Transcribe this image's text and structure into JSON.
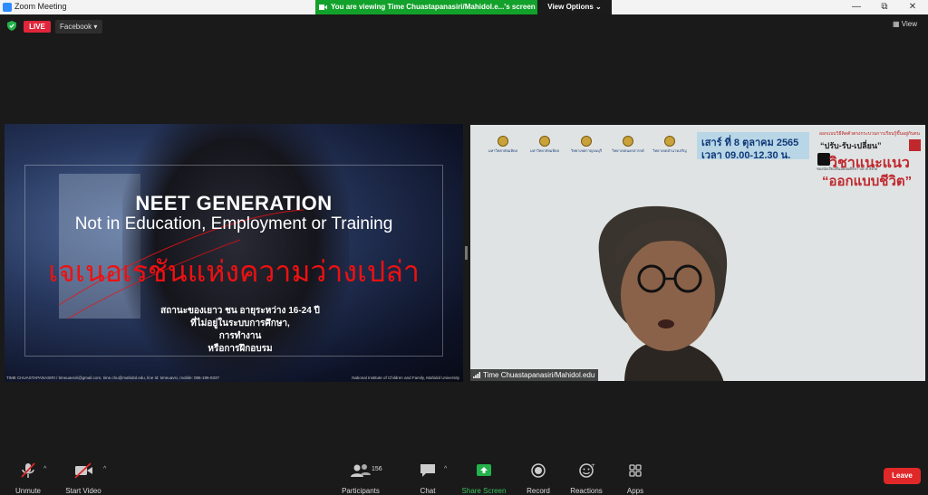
{
  "window": {
    "title": "Zoom Meeting",
    "banner_text": "You are viewing Time Chuastapanasiri/Mahidol.e...'s screen",
    "view_options_label": "View Options ⌄",
    "minimize": "—",
    "maximize": "⧉",
    "close": "✕"
  },
  "topbar": {
    "live_label": "LIVE",
    "live_platform": "Facebook ▾",
    "view_label": "View"
  },
  "shared_screen": {
    "title": "NEET GENERATION",
    "subtitle": "Not in Education, Employment or Training",
    "thai_title": "เจเนอเรชันแห่งความว่างเปล่า",
    "description": "สถานะของเยาว ชน อายุระหว่าง 16-24 ปี\nที่ไม่อยู่ในระบบการศึกษา,\nการทำงาน\nหรือการฝึกอบรม",
    "footer_left": "TIME CHUASTAPANASIRI / timeuavsiri@gmail.com, time.chu@mahidol.edu, line Id: timeuavsi, mobile: 086-195-9337",
    "footer_right": "National Institute of Children and Family, Mahidol University"
  },
  "participant_video": {
    "name": "Time Chuastapanasiri/Mahidol.edu",
    "logos": [
      {
        "name": "มหาวิทยาลัยมหิดล"
      },
      {
        "name": "มหาวิทยาลัยมหิดล"
      },
      {
        "name": "วิทยาเขตกาญจนบุรี"
      },
      {
        "name": "วิทยาเขตนครสวรรค์"
      },
      {
        "name": "วิทยาเขตอำนาจเจริญ"
      }
    ],
    "date_line1": "เสาร์ ที่ 8 ตุลาคม 2565",
    "date_line2": "เวลา 09.00-12.30 น.",
    "tag_small": "ออกแบบวิธีคิดตัวตรงกระบวนการเรียนรู้ขึ้นอยู่กับตน",
    "tag_quote1": "“ปรับ-รับ-เปลี่ยน”",
    "tag_main": "วิชาแนะแนว",
    "tag_sub": "ของนักเรียนชั้นมัธยมศึกษา ปลาย สังกัด",
    "tag_quote2": "“ออกแบบชีวิต”"
  },
  "toolbar": {
    "unmute": "Unmute",
    "start_video": "Start Video",
    "participants": "Participants",
    "participants_count": "156",
    "chat": "Chat",
    "share_screen": "Share Screen",
    "record": "Record",
    "reactions": "Reactions",
    "apps": "Apps",
    "leave": "Leave",
    "caret": "^"
  },
  "colors": {
    "share_green": "#12a12a",
    "live_red": "#e0263b",
    "leave_red": "#e02828"
  }
}
